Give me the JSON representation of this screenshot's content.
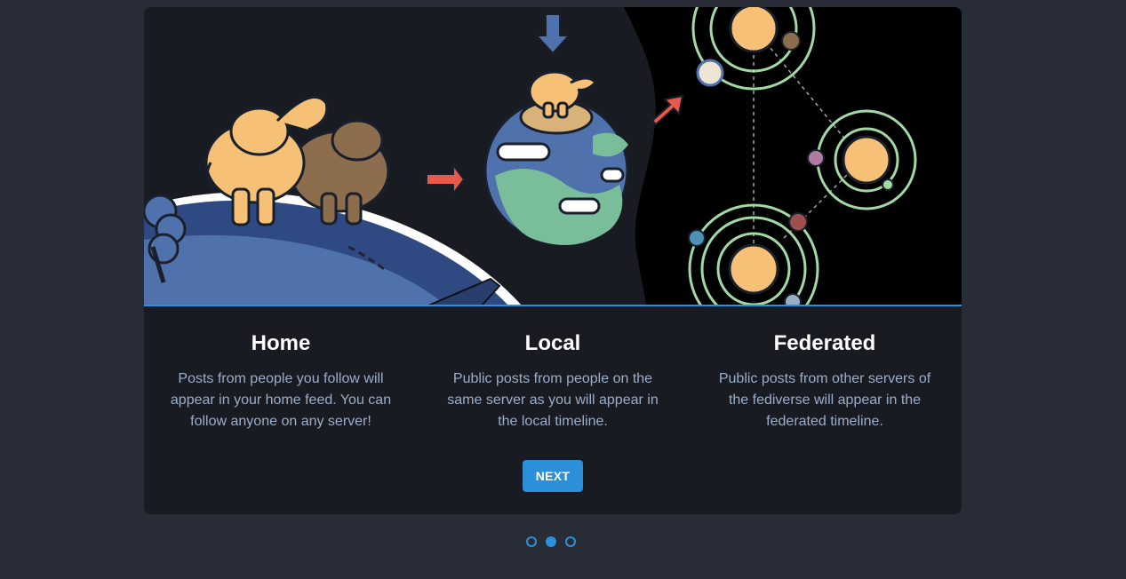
{
  "columns": [
    {
      "title": "Home",
      "text": "Posts from people you follow will appear in your home feed. You can follow anyone on any server!"
    },
    {
      "title": "Local",
      "text": "Public posts from people on the same server as you will appear in the local timeline."
    },
    {
      "title": "Federated",
      "text": "Public posts from other servers of the fediverse will appear in the federated timeline."
    }
  ],
  "next_label": "NEXT",
  "pager": {
    "total": 3,
    "active": 1
  },
  "colors": {
    "page_bg": "#282c37",
    "modal_bg": "#191b22",
    "accent": "#2b90d9",
    "body_text": "#9baec8"
  }
}
